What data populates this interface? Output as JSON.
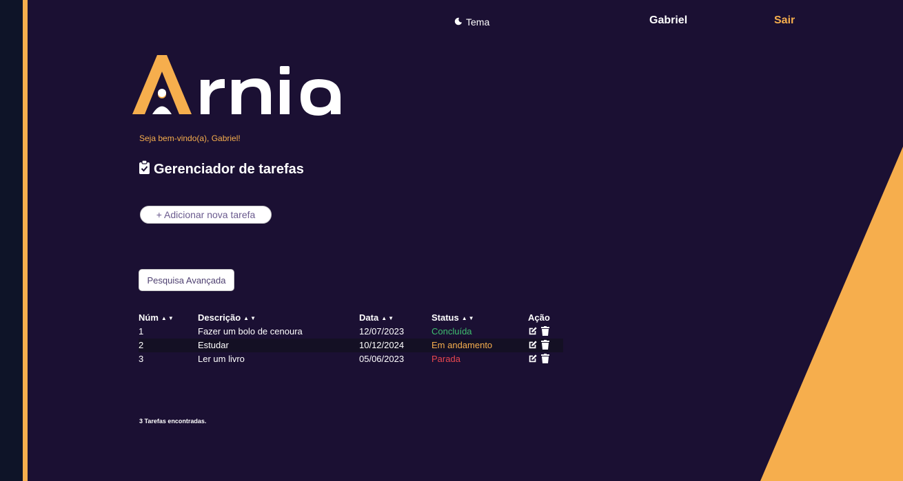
{
  "header": {
    "theme_label": "Tema",
    "theme_icon": "moon-icon",
    "user_name": "Gabriel",
    "logout_label": "Sair"
  },
  "brand": {
    "logo_text": "Arnia",
    "accent_color": "#f6ae4d",
    "background_color": "#1b1033"
  },
  "welcome_text": "Seja bem-vindo(a), Gabriel!",
  "page_title": "Gerenciador de tarefas",
  "page_title_icon": "clipboard-check-icon",
  "add_task_button": "+ Adicionar nova tarefa",
  "advanced_search_button": "Pesquisa Avançada",
  "table": {
    "columns": [
      "Núm",
      "Descrição",
      "Data",
      "Status",
      "Ação"
    ],
    "rows": [
      {
        "num": "1",
        "description": "Fazer um bolo de cenoura",
        "date": "12/07/2023",
        "status": "Concluída",
        "status_color": "#3fbf6f"
      },
      {
        "num": "2",
        "description": "Estudar",
        "date": "10/12/2024",
        "status": "Em andamento",
        "status_color": "#f6ae4d"
      },
      {
        "num": "3",
        "description": "Ler um livro",
        "date": "05/06/2023",
        "status": "Parada",
        "status_color": "#e8474f"
      }
    ]
  },
  "footer_count": "3 Tarefas encontradas."
}
